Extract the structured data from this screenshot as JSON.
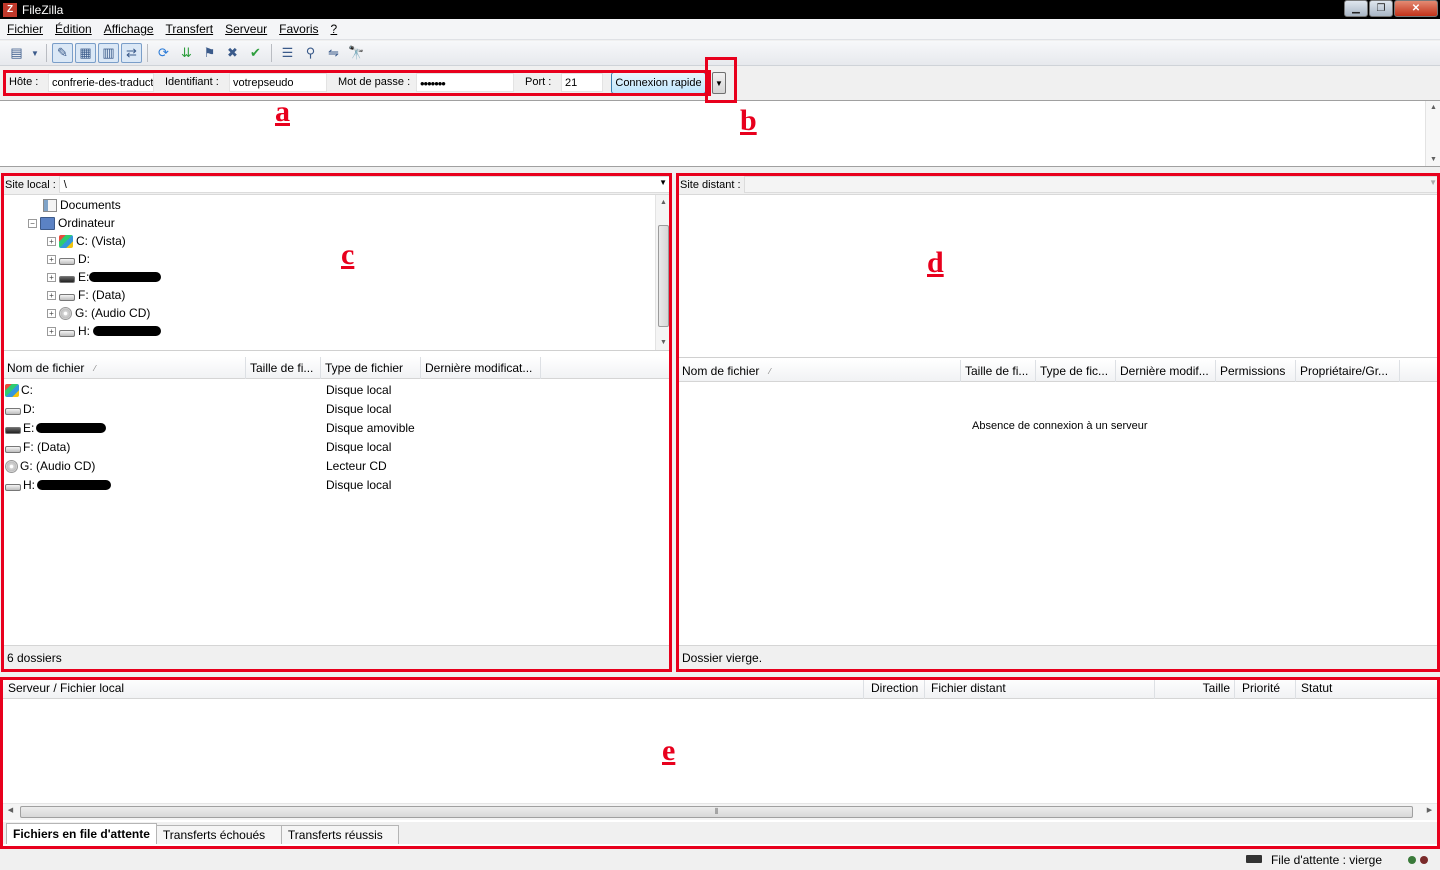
{
  "window": {
    "title": "FileZilla",
    "controls": [
      "minimize-icon",
      "maximize-icon",
      "close-icon"
    ]
  },
  "menu": {
    "items": [
      "Fichier",
      "Édition",
      "Affichage",
      "Transfert",
      "Serveur",
      "Favoris",
      "?"
    ]
  },
  "toolbar": {
    "buttons": [
      "site-manager-icon",
      "dropdown-icon",
      "toggle-message-log-icon",
      "toggle-local-tree-icon",
      "toggle-remote-tree-icon",
      "toggle-queue-icon",
      "refresh-icon",
      "process-queue-icon",
      "cancel-icon",
      "disconnect-icon",
      "reconnect-icon",
      "directory-listing-filter-icon",
      "compare-icon",
      "sync-browse-icon",
      "search-icon"
    ]
  },
  "quickconnect": {
    "host_label": "Hôte :",
    "host_value": "confrerie-des-traducteurs",
    "user_label": "Identifiant :",
    "user_value": "votrepseudo",
    "pass_label": "Mot de passe :",
    "pass_value": "•••••••",
    "port_label": "Port :",
    "port_value": "21",
    "connect_label": "Connexion rapide"
  },
  "local": {
    "path_label": "Site local :",
    "path_value": "\\",
    "tree": [
      {
        "label": "Documents",
        "icon": "documents-icon"
      },
      {
        "label": "Ordinateur",
        "icon": "computer-icon"
      },
      {
        "label": "C: (Vista)",
        "icon": "windows-drive-icon"
      },
      {
        "label": "D:",
        "icon": "drive-icon"
      },
      {
        "label": "E:",
        "icon": "removable-drive-icon"
      },
      {
        "label": "F: (Data)",
        "icon": "drive-icon"
      },
      {
        "label": "G: (Audio CD)",
        "icon": "cd-icon"
      },
      {
        "label": "H:",
        "icon": "drive-icon"
      }
    ],
    "columns": [
      "Nom de fichier",
      "Taille de fi...",
      "Type de fichier",
      "Dernière modificat..."
    ],
    "files": [
      {
        "name": "C:",
        "type": "Disque local",
        "icon": "windows-drive-icon"
      },
      {
        "name": "D:",
        "type": "Disque local",
        "icon": "drive-icon"
      },
      {
        "name": "E:",
        "type": "Disque amovible",
        "icon": "removable-drive-icon"
      },
      {
        "name": "F: (Data)",
        "type": "Disque local",
        "icon": "drive-icon"
      },
      {
        "name": "G: (Audio CD)",
        "type": "Lecteur CD",
        "icon": "cd-icon"
      },
      {
        "name": "H:",
        "type": "Disque local",
        "icon": "drive-icon"
      }
    ],
    "status": "6 dossiers"
  },
  "remote": {
    "path_label": "Site distant :",
    "path_value": "",
    "columns": [
      "Nom de fichier",
      "Taille de fi...",
      "Type de fic...",
      "Dernière modif...",
      "Permissions",
      "Propriétaire/Gr..."
    ],
    "empty_message": "Absence de connexion à un serveur",
    "status": "Dossier vierge."
  },
  "queue": {
    "columns": [
      "Serveur / Fichier local",
      "Direction",
      "Fichier distant",
      "Taille",
      "Priorité",
      "Statut"
    ],
    "tabs": [
      "Fichiers en file d'attente",
      "Transferts échoués",
      "Transferts réussis"
    ]
  },
  "statusbar": {
    "queue_status": "File d'attente : vierge"
  },
  "annotations": [
    "a",
    "b",
    "c",
    "d",
    "e"
  ],
  "colors": {
    "annotation": "#e8001d"
  }
}
